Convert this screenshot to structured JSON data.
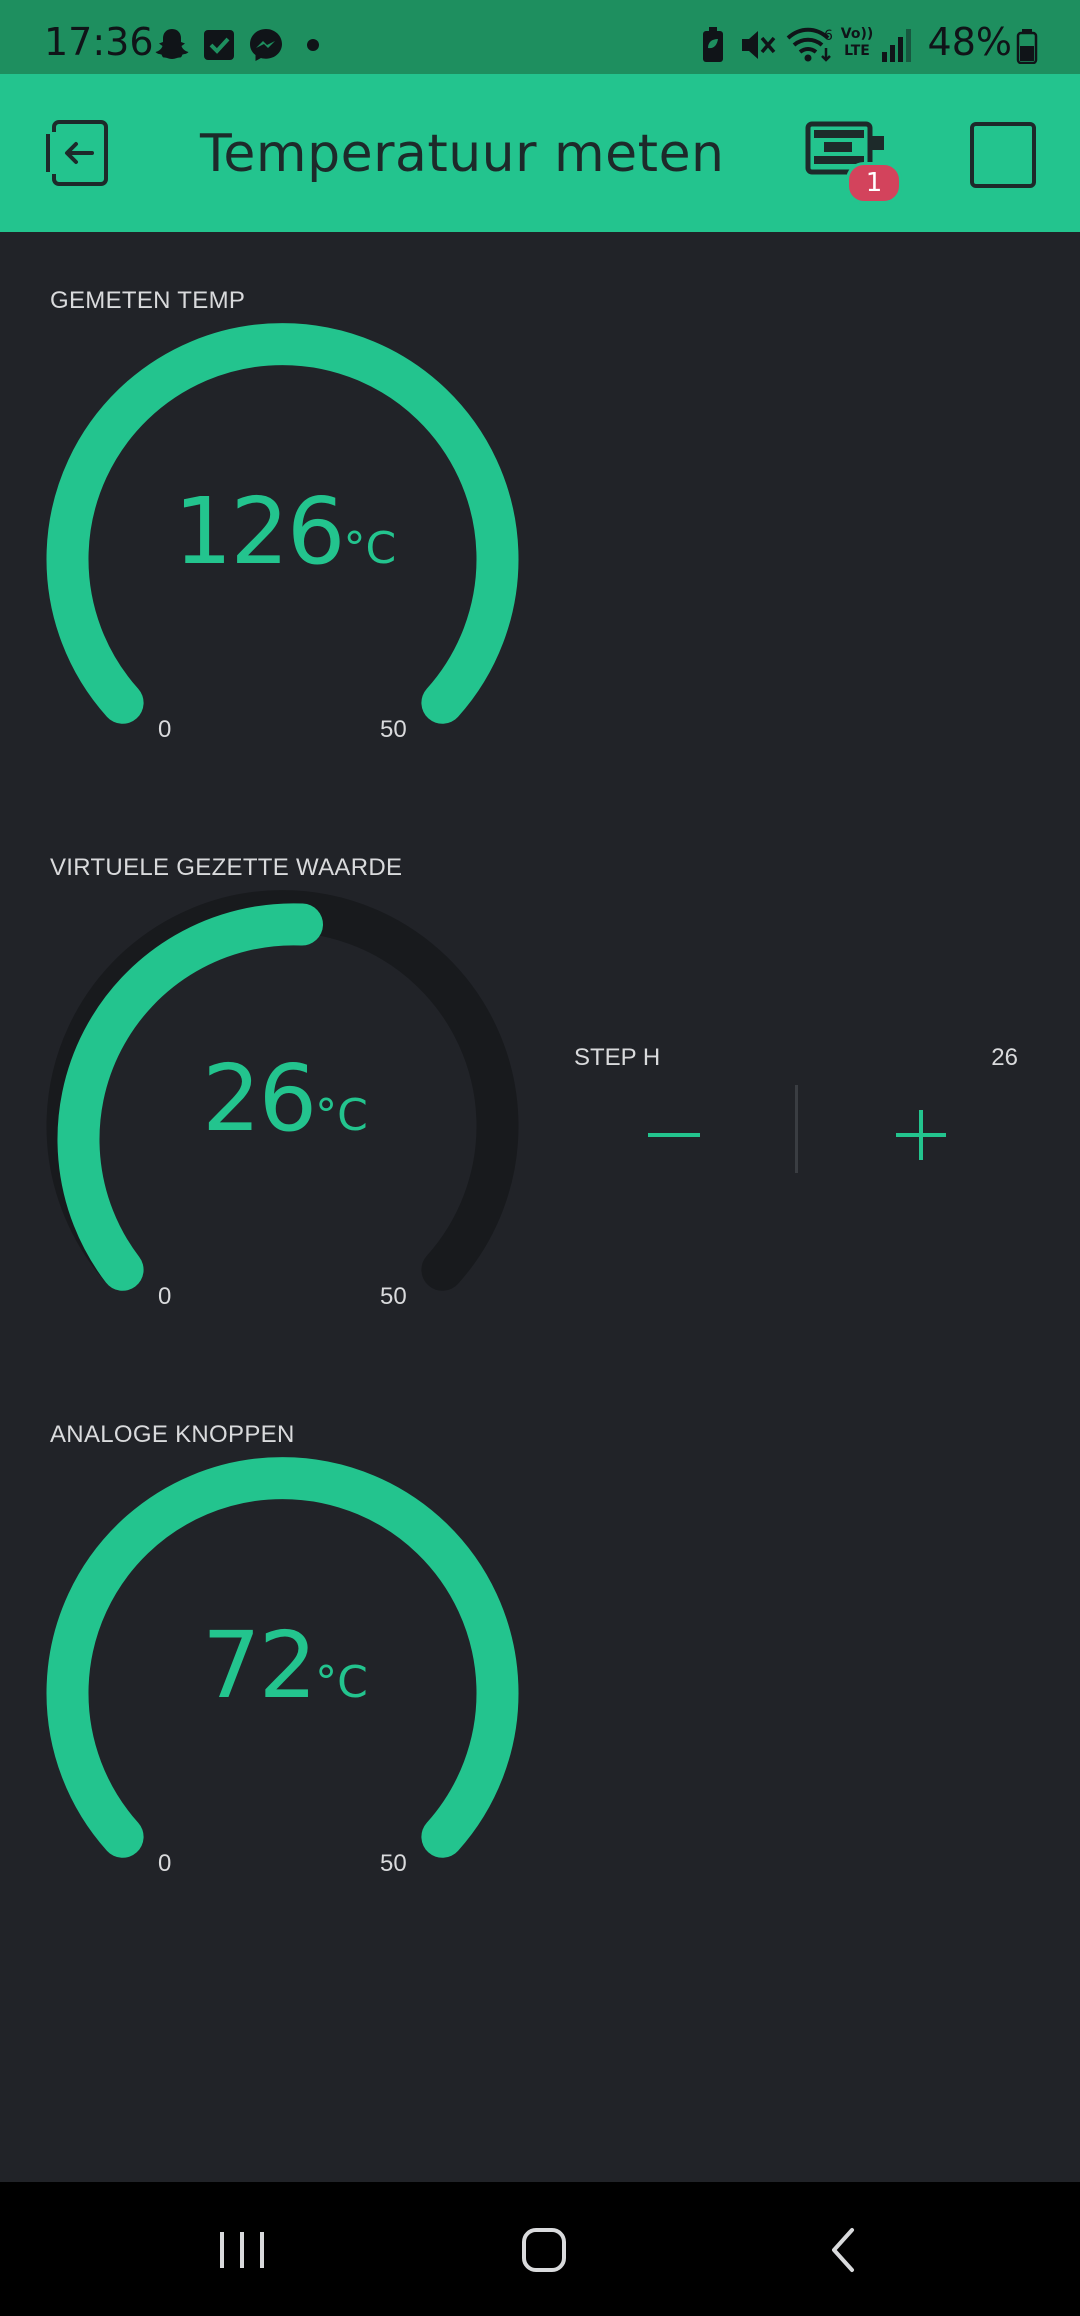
{
  "status_bar": {
    "time": "17:36",
    "battery": "48%",
    "icons_left": [
      "snapchat-icon",
      "checkbox-app-icon",
      "messenger-icon",
      "dot-icon"
    ],
    "icons_right": [
      "battery-saver-icon",
      "mute-icon",
      "wifi-6-icon",
      "volte-icon",
      "signal-icon",
      "battery-icon"
    ],
    "volte_text": "Vo)) LTE"
  },
  "app_bar": {
    "title": "Temperatuur meten",
    "device_badge_count": "1",
    "background": "#23c48e"
  },
  "widgets": {
    "gauge1": {
      "label": "GEMETEN TEMP",
      "value": "126",
      "unit": "°C",
      "min": "0",
      "max": "50"
    },
    "gauge2": {
      "label": "VIRTUELE GEZETTE WAARDE",
      "value": "26",
      "unit": "°C",
      "min": "0",
      "max": "50"
    },
    "gauge3": {
      "label": "ANALOGE KNOPPEN",
      "value": "72",
      "unit": "°C",
      "min": "0",
      "max": "50"
    },
    "step": {
      "label": "STEP H",
      "value": "26"
    }
  },
  "colors": {
    "accent": "#23c48e",
    "background": "#212328",
    "track": "#181a1d",
    "label": "#d9dadc",
    "badge": "#d3435c"
  }
}
